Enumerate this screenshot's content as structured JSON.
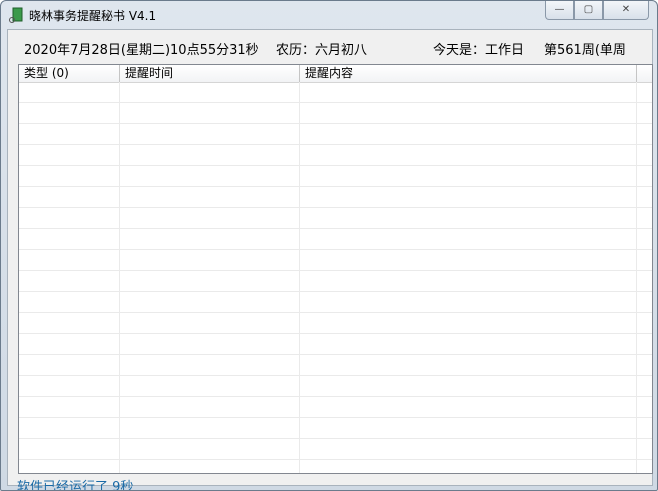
{
  "window": {
    "title": "晓林事务提醒秘书 V4.1",
    "min": "—",
    "max": "▢",
    "close": "✕"
  },
  "info": {
    "datetime": "2020年7月28日(星期二)10点55分31秒",
    "lunar": "农历：六月初八",
    "today": "今天是：工作日",
    "week": "第561周(单周"
  },
  "list": {
    "columns": [
      "类型 (0)",
      "提醒时间",
      "提醒内容"
    ]
  },
  "status": "软件已经运行了 9秒"
}
